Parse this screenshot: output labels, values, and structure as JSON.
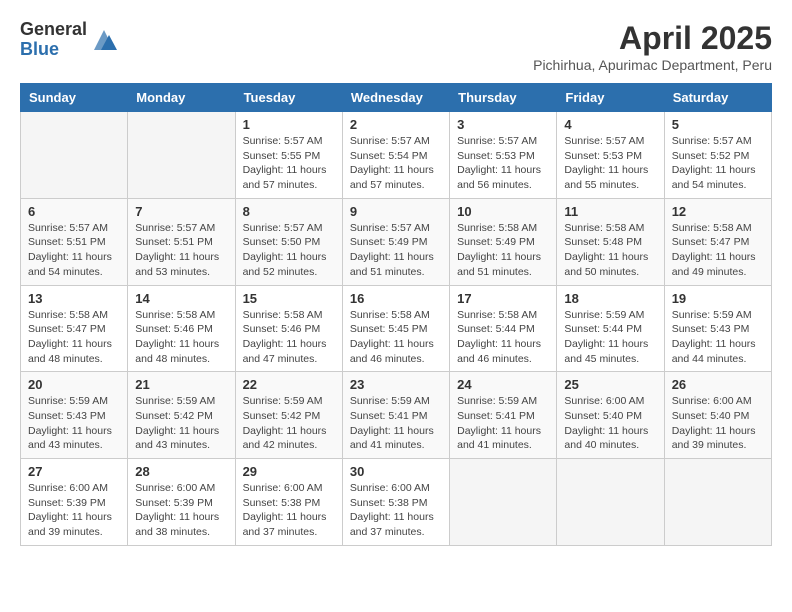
{
  "header": {
    "logo_general": "General",
    "logo_blue": "Blue",
    "month_year": "April 2025",
    "location": "Pichirhua, Apurimac Department, Peru"
  },
  "days_of_week": [
    "Sunday",
    "Monday",
    "Tuesday",
    "Wednesday",
    "Thursday",
    "Friday",
    "Saturday"
  ],
  "weeks": [
    [
      {
        "day": "",
        "info": ""
      },
      {
        "day": "",
        "info": ""
      },
      {
        "day": "1",
        "info": "Sunrise: 5:57 AM\nSunset: 5:55 PM\nDaylight: 11 hours and 57 minutes."
      },
      {
        "day": "2",
        "info": "Sunrise: 5:57 AM\nSunset: 5:54 PM\nDaylight: 11 hours and 57 minutes."
      },
      {
        "day": "3",
        "info": "Sunrise: 5:57 AM\nSunset: 5:53 PM\nDaylight: 11 hours and 56 minutes."
      },
      {
        "day": "4",
        "info": "Sunrise: 5:57 AM\nSunset: 5:53 PM\nDaylight: 11 hours and 55 minutes."
      },
      {
        "day": "5",
        "info": "Sunrise: 5:57 AM\nSunset: 5:52 PM\nDaylight: 11 hours and 54 minutes."
      }
    ],
    [
      {
        "day": "6",
        "info": "Sunrise: 5:57 AM\nSunset: 5:51 PM\nDaylight: 11 hours and 54 minutes."
      },
      {
        "day": "7",
        "info": "Sunrise: 5:57 AM\nSunset: 5:51 PM\nDaylight: 11 hours and 53 minutes."
      },
      {
        "day": "8",
        "info": "Sunrise: 5:57 AM\nSunset: 5:50 PM\nDaylight: 11 hours and 52 minutes."
      },
      {
        "day": "9",
        "info": "Sunrise: 5:57 AM\nSunset: 5:49 PM\nDaylight: 11 hours and 51 minutes."
      },
      {
        "day": "10",
        "info": "Sunrise: 5:58 AM\nSunset: 5:49 PM\nDaylight: 11 hours and 51 minutes."
      },
      {
        "day": "11",
        "info": "Sunrise: 5:58 AM\nSunset: 5:48 PM\nDaylight: 11 hours and 50 minutes."
      },
      {
        "day": "12",
        "info": "Sunrise: 5:58 AM\nSunset: 5:47 PM\nDaylight: 11 hours and 49 minutes."
      }
    ],
    [
      {
        "day": "13",
        "info": "Sunrise: 5:58 AM\nSunset: 5:47 PM\nDaylight: 11 hours and 48 minutes."
      },
      {
        "day": "14",
        "info": "Sunrise: 5:58 AM\nSunset: 5:46 PM\nDaylight: 11 hours and 48 minutes."
      },
      {
        "day": "15",
        "info": "Sunrise: 5:58 AM\nSunset: 5:46 PM\nDaylight: 11 hours and 47 minutes."
      },
      {
        "day": "16",
        "info": "Sunrise: 5:58 AM\nSunset: 5:45 PM\nDaylight: 11 hours and 46 minutes."
      },
      {
        "day": "17",
        "info": "Sunrise: 5:58 AM\nSunset: 5:44 PM\nDaylight: 11 hours and 46 minutes."
      },
      {
        "day": "18",
        "info": "Sunrise: 5:59 AM\nSunset: 5:44 PM\nDaylight: 11 hours and 45 minutes."
      },
      {
        "day": "19",
        "info": "Sunrise: 5:59 AM\nSunset: 5:43 PM\nDaylight: 11 hours and 44 minutes."
      }
    ],
    [
      {
        "day": "20",
        "info": "Sunrise: 5:59 AM\nSunset: 5:43 PM\nDaylight: 11 hours and 43 minutes."
      },
      {
        "day": "21",
        "info": "Sunrise: 5:59 AM\nSunset: 5:42 PM\nDaylight: 11 hours and 43 minutes."
      },
      {
        "day": "22",
        "info": "Sunrise: 5:59 AM\nSunset: 5:42 PM\nDaylight: 11 hours and 42 minutes."
      },
      {
        "day": "23",
        "info": "Sunrise: 5:59 AM\nSunset: 5:41 PM\nDaylight: 11 hours and 41 minutes."
      },
      {
        "day": "24",
        "info": "Sunrise: 5:59 AM\nSunset: 5:41 PM\nDaylight: 11 hours and 41 minutes."
      },
      {
        "day": "25",
        "info": "Sunrise: 6:00 AM\nSunset: 5:40 PM\nDaylight: 11 hours and 40 minutes."
      },
      {
        "day": "26",
        "info": "Sunrise: 6:00 AM\nSunset: 5:40 PM\nDaylight: 11 hours and 39 minutes."
      }
    ],
    [
      {
        "day": "27",
        "info": "Sunrise: 6:00 AM\nSunset: 5:39 PM\nDaylight: 11 hours and 39 minutes."
      },
      {
        "day": "28",
        "info": "Sunrise: 6:00 AM\nSunset: 5:39 PM\nDaylight: 11 hours and 38 minutes."
      },
      {
        "day": "29",
        "info": "Sunrise: 6:00 AM\nSunset: 5:38 PM\nDaylight: 11 hours and 37 minutes."
      },
      {
        "day": "30",
        "info": "Sunrise: 6:00 AM\nSunset: 5:38 PM\nDaylight: 11 hours and 37 minutes."
      },
      {
        "day": "",
        "info": ""
      },
      {
        "day": "",
        "info": ""
      },
      {
        "day": "",
        "info": ""
      }
    ]
  ]
}
